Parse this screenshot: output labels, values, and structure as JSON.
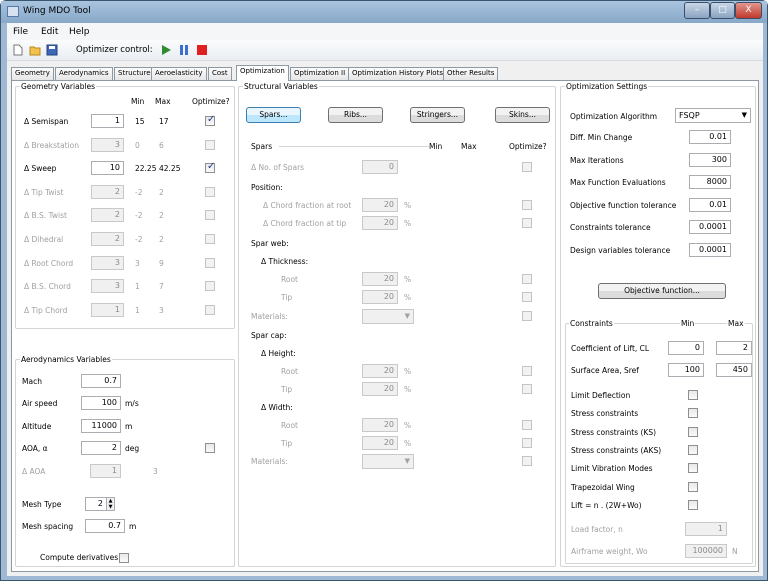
{
  "window": {
    "title": "Wing MDO Tool",
    "min": "–",
    "max": "□",
    "close": "X"
  },
  "menu": [
    "File",
    "Edit",
    "Help"
  ],
  "toolbar": {
    "optimizer_label": "Optimizer control:"
  },
  "tabs": [
    "Geometry",
    "Aerodynamics",
    "Structure",
    "Aeroelasticity",
    "Cost",
    "Optimization",
    "Optimization II",
    "Optimization History Plots",
    "Other Results"
  ],
  "geometry": {
    "title": "Geometry Variables",
    "col_min": "Min",
    "col_max": "Max",
    "col_opt": "Optimize?",
    "rows": [
      {
        "label": "Δ Semispan",
        "value": "1",
        "min": "15",
        "max": "17",
        "checked": true,
        "enabled": true
      },
      {
        "label": "Δ Breakstation",
        "value": "3",
        "min": "0",
        "max": "6",
        "checked": false,
        "enabled": false
      },
      {
        "label": "Δ Sweep",
        "value": "10",
        "min": "22.25",
        "max": "42.25",
        "checked": true,
        "enabled": true
      },
      {
        "label": "Δ Tip Twist",
        "value": "2",
        "min": "-2",
        "max": "2",
        "checked": false,
        "enabled": false
      },
      {
        "label": "Δ B.S. Twist",
        "value": "2",
        "min": "-2",
        "max": "2",
        "checked": false,
        "enabled": false
      },
      {
        "label": "Δ Dihedral",
        "value": "2",
        "min": "-2",
        "max": "2",
        "checked": false,
        "enabled": false
      },
      {
        "label": "Δ Root Chord",
        "value": "3",
        "min": "3",
        "max": "9",
        "checked": false,
        "enabled": false
      },
      {
        "label": "Δ B.S. Chord",
        "value": "3",
        "min": "1",
        "max": "7",
        "checked": false,
        "enabled": false
      },
      {
        "label": "Δ Tip Chord",
        "value": "1",
        "min": "1",
        "max": "3",
        "checked": false,
        "enabled": false
      }
    ]
  },
  "aero": {
    "title": "Aerodynamics Variables",
    "mach_label": "Mach",
    "mach": "0.7",
    "airspeed_label": "Air speed",
    "airspeed": "100",
    "airspeed_unit": "m/s",
    "altitude_label": "Altitude",
    "altitude": "11000",
    "altitude_unit": "m",
    "aoa_label": "AOA, α",
    "aoa": "2",
    "aoa_unit": "deg",
    "daoa_label": "Δ AOA",
    "daoa": "1",
    "daoa_max": "3",
    "mesh_type_label": "Mesh Type",
    "mesh_type": "2",
    "mesh_spacing_label": "Mesh spacing",
    "mesh_spacing": "0.7",
    "mesh_spacing_unit": "m",
    "compute_deriv_label": "Compute derivatives"
  },
  "structural": {
    "title": "Structural Variables",
    "btn_spars": "Spars...",
    "btn_ribs": "Ribs...",
    "btn_stringers": "Stringers...",
    "btn_skins": "Skins...",
    "spars_title": "Spars",
    "col_min": "Min",
    "col_max": "Max",
    "col_opt": "Optimize?",
    "no_spars_label": "Δ No. of Spars",
    "no_spars": "0",
    "position_label": "Position:",
    "chord_root_label": "Δ Chord fraction at root",
    "chord_root": "20",
    "chord_tip_label": "Δ Chord fraction at tip",
    "chord_tip": "20",
    "pct": "%",
    "spar_web_label": "Spar web:",
    "thickness_label": "Δ Thickness:",
    "root_label": "Root",
    "tip_label": "Tip",
    "web_root": "20",
    "web_tip": "20",
    "materials_label": "Materials:",
    "spar_cap_label": "Spar cap:",
    "height_label": "Δ Height:",
    "cap_h_root": "20",
    "cap_h_tip": "20",
    "width_label": "Δ Width:",
    "cap_w_root": "20",
    "cap_w_tip": "20"
  },
  "settings": {
    "title": "Optimization Settings",
    "algorithm_label": "Optimization Algorithm",
    "algorithm": "FSQP",
    "rows": [
      {
        "label": "Diff. Min Change",
        "value": "0.01"
      },
      {
        "label": "Max Iterations",
        "value": "300"
      },
      {
        "label": "Max Function Evaluations",
        "value": "8000"
      },
      {
        "label": "Objective function tolerance",
        "value": "0.01"
      },
      {
        "label": "Constraints tolerance",
        "value": "0.0001"
      },
      {
        "label": "Design variables tolerance",
        "value": "0.0001"
      }
    ],
    "objective_btn": "Objective function..."
  },
  "constraints": {
    "title": "Constraints",
    "col_min": "Min",
    "col_max": "Max",
    "cl_label": "Coefficient of Lift, CL",
    "cl_min": "0",
    "cl_max": "2",
    "sref_label": "Surface Area, Sref",
    "sref_min": "100",
    "sref_max": "450",
    "checks": [
      "Limit Deflection",
      "Stress constraints",
      "Stress constraints (KS)",
      "Stress constraints (AKS)",
      "Limit Vibration Modes",
      "Trapezoidal Wing",
      "Lift = n . (2W+Wo)"
    ],
    "load_factor_label": "Load factor, n",
    "load_factor": "1",
    "airframe_label": "Airframe weight, Wo",
    "airframe": "100000",
    "airframe_unit": "N"
  },
  "colors": {
    "accent_check": "#2a3c85",
    "play": "#2e8b2e",
    "pause": "#3b6fd0",
    "stop": "#e02020",
    "close": "#c9463d"
  }
}
